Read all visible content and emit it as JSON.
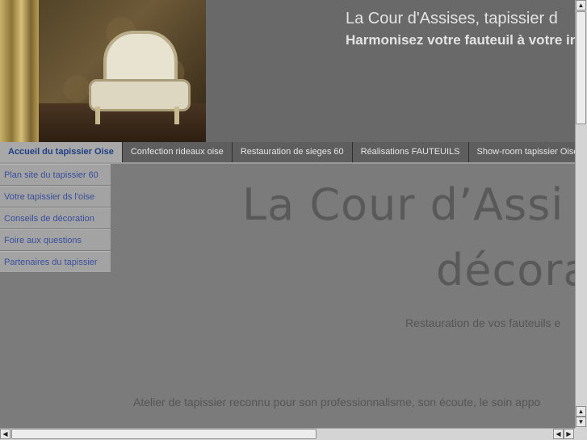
{
  "header": {
    "title": "La Cour d'Assises, tapissier d",
    "subtitle": "Harmonisez votre fauteuil à votre inte"
  },
  "topnav": {
    "tabs": [
      {
        "label": "Accueil du tapissier Oise",
        "active": true
      },
      {
        "label": "Confection rideaux oise",
        "active": false
      },
      {
        "label": "Restauration de sieges 60",
        "active": false
      },
      {
        "label": "Réalisations FAUTEUILS",
        "active": false
      },
      {
        "label": "Show-room tapissier Oise",
        "active": false
      }
    ]
  },
  "sidenav": {
    "items": [
      {
        "label": "Plan site du tapissier 60"
      },
      {
        "label": "Votre tapissier ds l'oise"
      },
      {
        "label": "Conseils de décoration"
      },
      {
        "label": "Foire aux questions"
      },
      {
        "label": "Partenaires du tapissier"
      }
    ]
  },
  "main": {
    "heading_line1": "La Cour  d’Assi",
    "heading_line2": "décora",
    "tagline": "Restauration de vos fauteuils e",
    "intro": "Atelier de tapissier reconnu pour son professionnalisme, son écoute, le soin appo"
  },
  "icons": {
    "scroll_up": "scroll-up-arrow-icon",
    "scroll_down": "scroll-down-arrow-icon",
    "scroll_left": "scroll-left-arrow-icon",
    "scroll_right": "scroll-right-arrow-icon"
  },
  "colors": {
    "active_tab_text": "#1f3f86",
    "side_link_text": "#3a4f9c",
    "header_background": "#696969"
  }
}
